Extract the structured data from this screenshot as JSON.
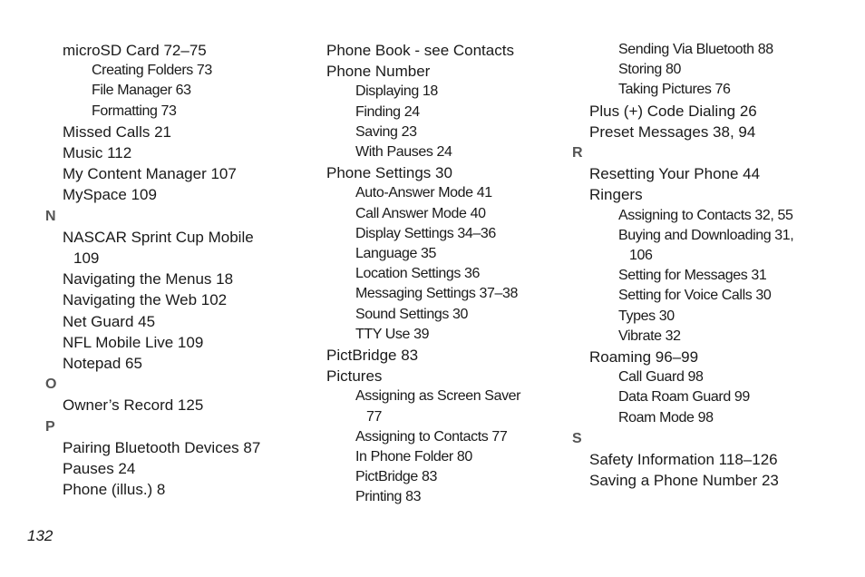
{
  "page_number": "132",
  "columns": [
    {
      "entries": [
        {
          "type": "sub0",
          "text": "microSD Card 72–75"
        },
        {
          "type": "sub1",
          "text": "Creating Folders 73"
        },
        {
          "type": "sub1",
          "text": "File Manager 63"
        },
        {
          "type": "sub1",
          "text": "Formatting 73"
        },
        {
          "type": "sub0",
          "text": "Missed Calls 21"
        },
        {
          "type": "sub0",
          "text": "Music 112"
        },
        {
          "type": "sub0",
          "text": "My Content Manager 107"
        },
        {
          "type": "sub0",
          "text": "MySpace 109"
        },
        {
          "type": "letter",
          "text": "N"
        },
        {
          "type": "sub0",
          "text": "NASCAR Sprint Cup Mobile",
          "cont": "109"
        },
        {
          "type": "sub0",
          "text": "Navigating the Menus 18"
        },
        {
          "type": "sub0",
          "text": "Navigating the Web 102"
        },
        {
          "type": "sub0",
          "text": "Net Guard 45"
        },
        {
          "type": "sub0",
          "text": "NFL Mobile Live 109"
        },
        {
          "type": "sub0",
          "text": "Notepad 65"
        },
        {
          "type": "letter",
          "text": "O"
        },
        {
          "type": "sub0",
          "text": "Owner’s Record 125"
        },
        {
          "type": "letter",
          "text": "P"
        },
        {
          "type": "sub0",
          "text": "Pairing Bluetooth Devices 87"
        },
        {
          "type": "sub0",
          "text": "Pauses 24"
        },
        {
          "type": "sub0",
          "text": "Phone (illus.) 8"
        }
      ]
    },
    {
      "entries": [
        {
          "type": "sub0",
          "text": "Phone Book - see Contacts"
        },
        {
          "type": "sub0",
          "text": "Phone Number"
        },
        {
          "type": "sub1",
          "text": "Displaying 18"
        },
        {
          "type": "sub1",
          "text": "Finding 24"
        },
        {
          "type": "sub1",
          "text": "Saving 23"
        },
        {
          "type": "sub1",
          "text": "With Pauses 24"
        },
        {
          "type": "sub0",
          "text": "Phone Settings 30"
        },
        {
          "type": "sub1",
          "text": "Auto-Answer Mode 41"
        },
        {
          "type": "sub1",
          "text": "Call Answer Mode 40"
        },
        {
          "type": "sub1",
          "text": "Display Settings 34–36"
        },
        {
          "type": "sub1",
          "text": "Language 35"
        },
        {
          "type": "sub1",
          "text": "Location Settings 36"
        },
        {
          "type": "sub1",
          "text": "Messaging Settings 37–38"
        },
        {
          "type": "sub1",
          "text": "Sound Settings 30"
        },
        {
          "type": "sub1",
          "text": "TTY Use 39"
        },
        {
          "type": "sub0",
          "text": "PictBridge 83"
        },
        {
          "type": "sub0",
          "text": "Pictures"
        },
        {
          "type": "sub1",
          "text": "Assigning as Screen Saver",
          "cont": "77"
        },
        {
          "type": "sub1",
          "text": "Assigning to Contacts 77"
        },
        {
          "type": "sub1",
          "text": "In Phone Folder 80"
        },
        {
          "type": "sub1",
          "text": "PictBridge 83"
        },
        {
          "type": "sub1",
          "text": "Printing 83"
        }
      ]
    },
    {
      "entries": [
        {
          "type": "sub1",
          "text": "Sending Via Bluetooth 88"
        },
        {
          "type": "sub1",
          "text": "Storing 80"
        },
        {
          "type": "sub1",
          "text": "Taking Pictures 76"
        },
        {
          "type": "sub0",
          "text": "Plus (+) Code Dialing 26"
        },
        {
          "type": "sub0",
          "text": "Preset Messages 38, 94"
        },
        {
          "type": "letter",
          "text": "R"
        },
        {
          "type": "sub0",
          "text": "Resetting Your Phone 44"
        },
        {
          "type": "sub0",
          "text": "Ringers"
        },
        {
          "type": "sub1",
          "text": "Assigning to Contacts 32, 55"
        },
        {
          "type": "sub1",
          "text": "Buying and Downloading 31,",
          "cont": "106"
        },
        {
          "type": "sub1",
          "text": "Setting for Messages 31"
        },
        {
          "type": "sub1",
          "text": "Setting for Voice Calls 30"
        },
        {
          "type": "sub1",
          "text": "Types 30"
        },
        {
          "type": "sub1",
          "text": "Vibrate 32"
        },
        {
          "type": "sub0",
          "text": "Roaming 96–99"
        },
        {
          "type": "sub1",
          "text": "Call Guard 98"
        },
        {
          "type": "sub1",
          "text": "Data Roam Guard 99"
        },
        {
          "type": "sub1",
          "text": "Roam Mode 98"
        },
        {
          "type": "letter",
          "text": "S"
        },
        {
          "type": "sub0",
          "text": "Safety Information 118–126"
        },
        {
          "type": "sub0",
          "text": "Saving a Phone Number 23"
        }
      ]
    }
  ]
}
